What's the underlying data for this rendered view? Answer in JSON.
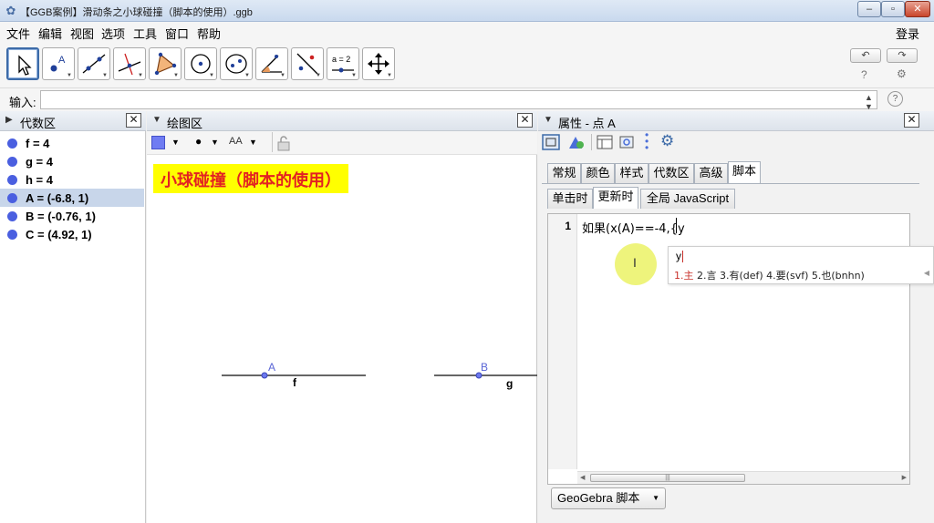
{
  "window": {
    "title": "【GGB案例】滑动条之小球碰撞（脚本的使用）.ggb",
    "minimize": "–",
    "maximize": "▫",
    "close": "✕"
  },
  "menu": {
    "items": [
      "文件",
      "编辑",
      "视图",
      "选项",
      "工具",
      "窗口",
      "帮助"
    ],
    "login": "登录"
  },
  "toolbar": {
    "slider_tool_label": "a = 2",
    "undo_icon": "↶",
    "redo_icon": "↷",
    "help_icon": "?",
    "settings_icon": "⚙"
  },
  "input_bar": {
    "label": "输入:",
    "value": "",
    "help": "?"
  },
  "algebra": {
    "title": "代数区",
    "items": [
      {
        "text": "f = 4",
        "color": "#4a5fe0"
      },
      {
        "text": "g = 4",
        "color": "#4a5fe0"
      },
      {
        "text": "h = 4",
        "color": "#4a5fe0"
      },
      {
        "text": "A = (-6.8, 1)",
        "color": "#4a5fe0",
        "selected": true
      },
      {
        "text": "B = (-0.76, 1)",
        "color": "#4a5fe0"
      },
      {
        "text": "C = (4.92, 1)",
        "color": "#4a5fe0"
      }
    ]
  },
  "graphics": {
    "title": "绘图区",
    "heading": "小球碰撞（脚本的使用）",
    "point_a": "A",
    "point_b": "B",
    "segment_f": "f",
    "segment_g": "g",
    "style_text": "AA"
  },
  "properties": {
    "title": "属性 - 点 A",
    "tabs": [
      "常规",
      "颜色",
      "样式",
      "代数区",
      "高级",
      "脚本"
    ],
    "active_tab": "脚本",
    "subtabs": [
      "单击时",
      "更新时",
      "全局 JavaScript"
    ],
    "active_subtab": "更新时",
    "line_number": "1",
    "script_text": "如果(x(A)==-4,{y",
    "script_language": "GeoGebra 脚本",
    "ime": {
      "composition": "y",
      "candidate_first": "1.主",
      "candidates_rest": " 2.言 3.有(def) 4.要(svf) 5.也(bnhn)"
    }
  },
  "colors": {
    "accent_blue": "#3d6ba8",
    "point_blue": "#4a5fe0",
    "heading_red": "#e32222",
    "heading_bg": "#ffff00"
  }
}
